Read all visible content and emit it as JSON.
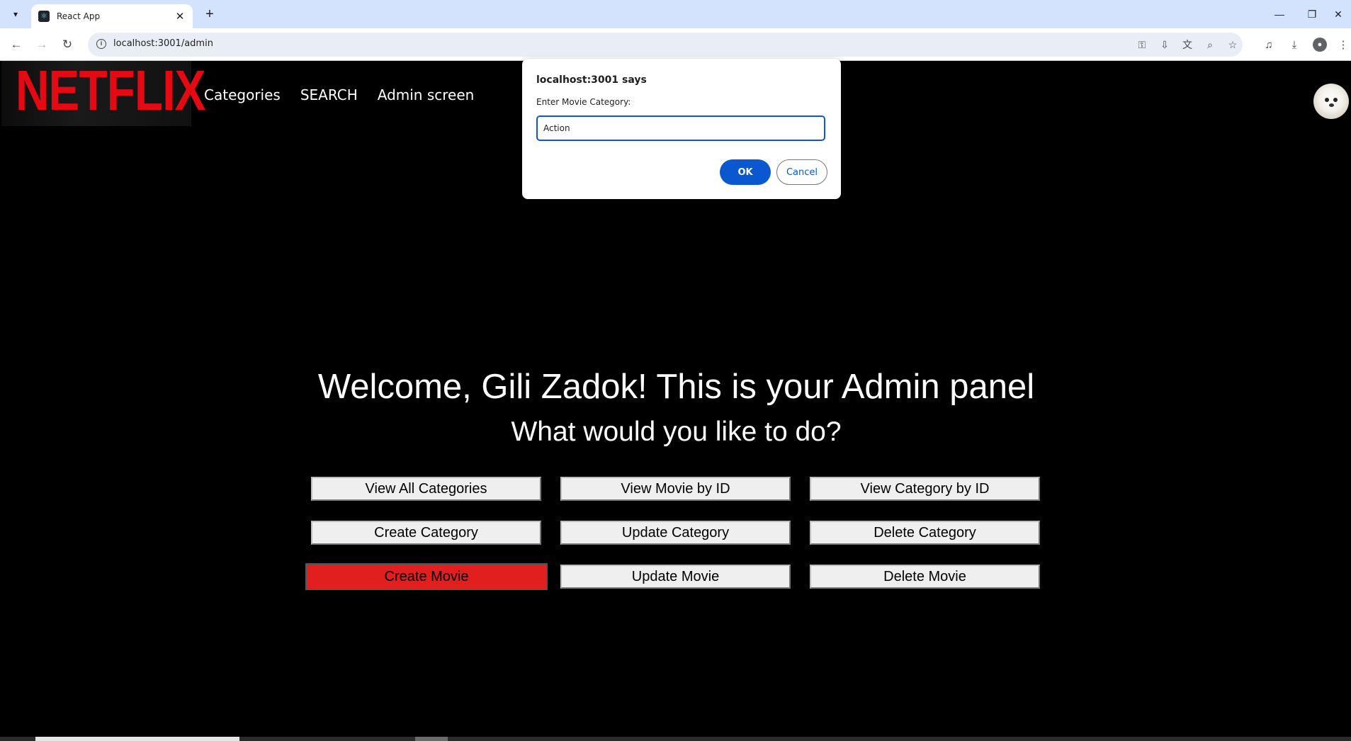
{
  "browser": {
    "tab_title": "React App",
    "tab_close": "✕",
    "new_tab": "+",
    "url": "localhost:3001/admin",
    "window_controls": {
      "minimize": "—",
      "restore": "❐",
      "close": "✕"
    },
    "icons": [
      "tab-search-icon",
      "back-icon",
      "forward-icon",
      "reload-icon",
      "site-info-icon",
      "password-key-icon",
      "install-app-icon",
      "translate-icon",
      "zoom-icon",
      "bookmark-star-icon",
      "media-control-icon",
      "download-icon",
      "profile-icon",
      "menu-icon"
    ]
  },
  "header": {
    "logo_text": "NETFLIX",
    "nav": [
      "Categories",
      "SEARCH",
      "Admin screen"
    ]
  },
  "main": {
    "welcome": "Welcome, Gili Zadok! This is your Admin panel",
    "question": "What would you like to do?",
    "buttons": [
      "View All Categories",
      "View Movie by ID",
      "View Category by ID",
      "Create Category",
      "Update Category",
      "Delete Category",
      "Create Movie",
      "Update Movie",
      "Delete Movie"
    ],
    "active_button": "Create Movie"
  },
  "dialog": {
    "title": "localhost:3001 says",
    "message": "Enter Movie Category:",
    "input_value": "Action",
    "ok_label": "OK",
    "cancel_label": "Cancel"
  },
  "colors": {
    "brand_red": "#e50914",
    "active_button": "#e21f1f",
    "dialog_primary": "#0b57d0",
    "tabstrip": "#d3e3fd"
  }
}
